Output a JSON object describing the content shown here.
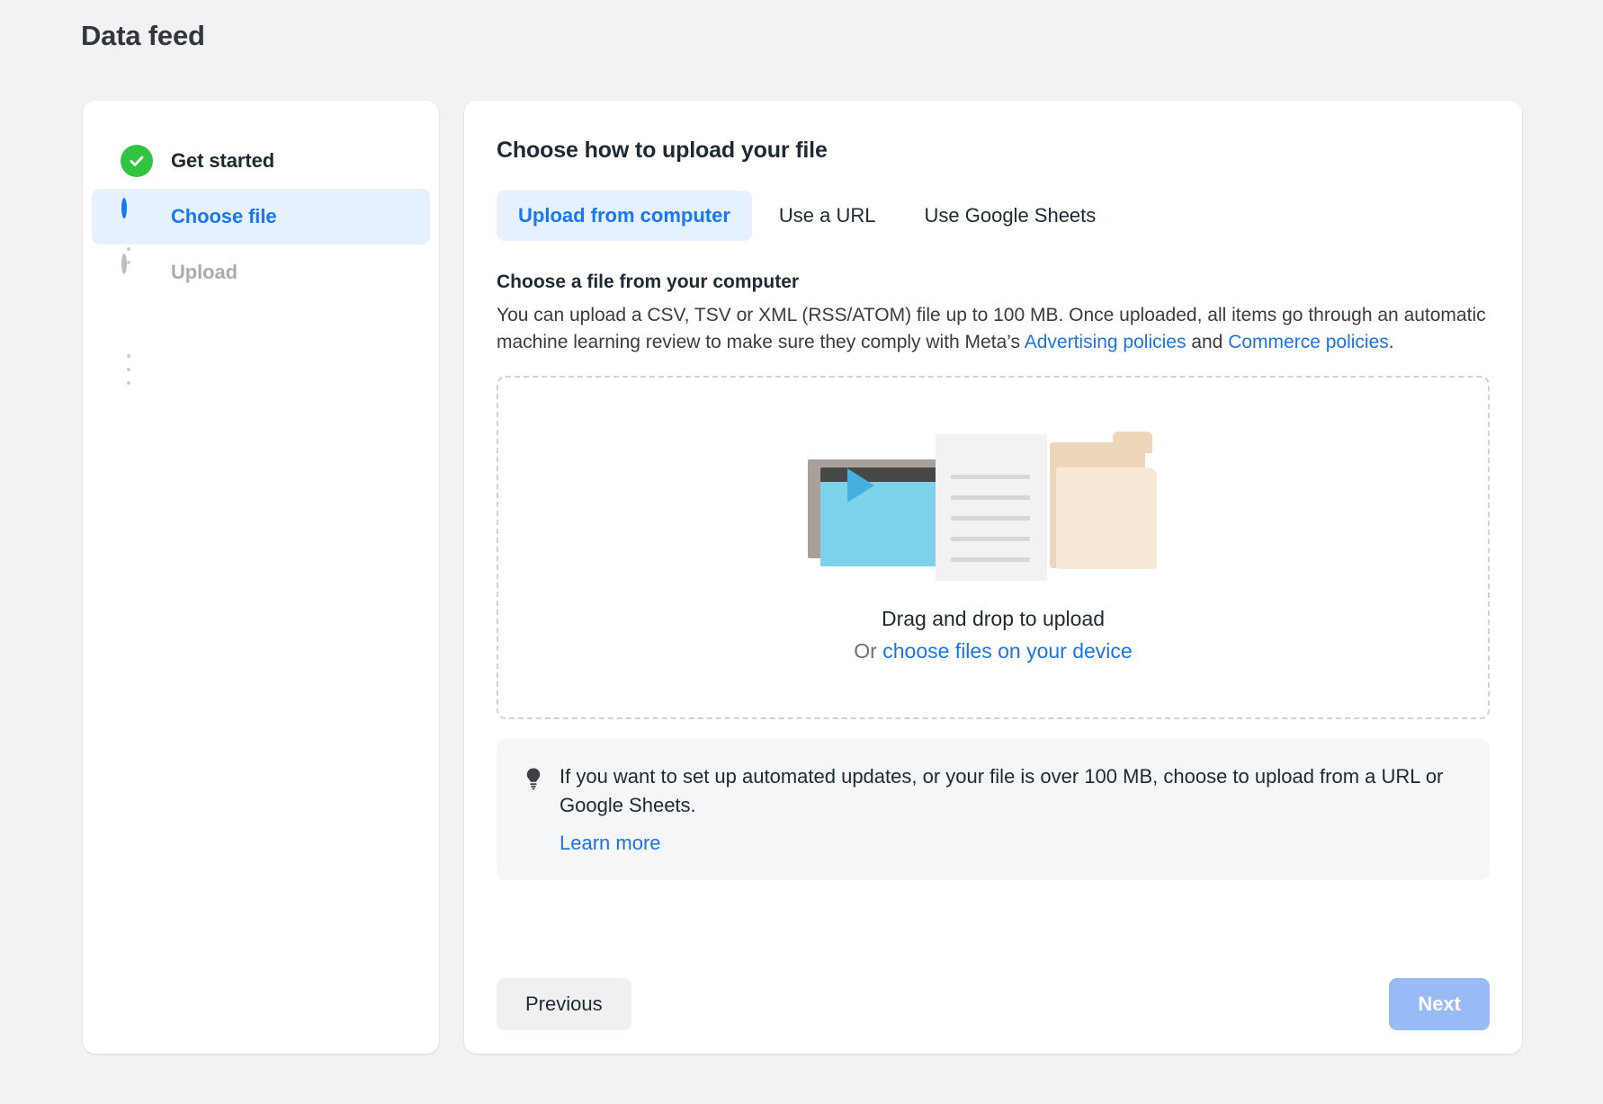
{
  "page": {
    "title": "Data feed"
  },
  "stepper": {
    "steps": [
      {
        "label": "Get started",
        "state": "done",
        "icon": "check-circle-icon"
      },
      {
        "label": "Choose file",
        "state": "active",
        "icon": "half-circle-icon"
      },
      {
        "label": "Upload",
        "state": "todo",
        "icon": "empty-circle-icon"
      }
    ]
  },
  "main": {
    "heading": "Choose how to upload your file",
    "tabs": [
      {
        "label": "Upload from computer",
        "active": true
      },
      {
        "label": "Use a URL",
        "active": false
      },
      {
        "label": "Use Google Sheets",
        "active": false
      }
    ],
    "section": {
      "sub_heading": "Choose a file from your computer",
      "description_part1": "You can upload a CSV, TSV or XML (RSS/ATOM) file up to 100 MB. Once uploaded, all items go through an automatic machine learning review to make sure they comply with Meta’s ",
      "link_advertising": "Advertising policies",
      "description_part2": " and ",
      "link_commerce": "Commerce policies",
      "description_part3": "."
    },
    "dropzone": {
      "primary_text": "Drag and drop to upload",
      "or_prefix": "Or ",
      "link_label": "choose files on your device",
      "illustration": "video-document-folder-illustration"
    },
    "tip": {
      "icon": "lightbulb-icon",
      "text": "If you want to set up automated updates, or your file is over 100 MB, choose to upload from a URL or Google Sheets.",
      "link_label": "Learn more"
    },
    "footer": {
      "previous_label": "Previous",
      "next_label": "Next",
      "next_disabled": true
    }
  },
  "colors": {
    "accent_blue": "#1877f2",
    "link_blue": "#1b74e4",
    "success_green": "#31c53f",
    "page_background": "#f1f2f3",
    "card_background": "#ffffff",
    "active_pill": "#e7f0fd",
    "muted_text": "#a8adb3",
    "disabled_primary": "#93b8f5"
  }
}
